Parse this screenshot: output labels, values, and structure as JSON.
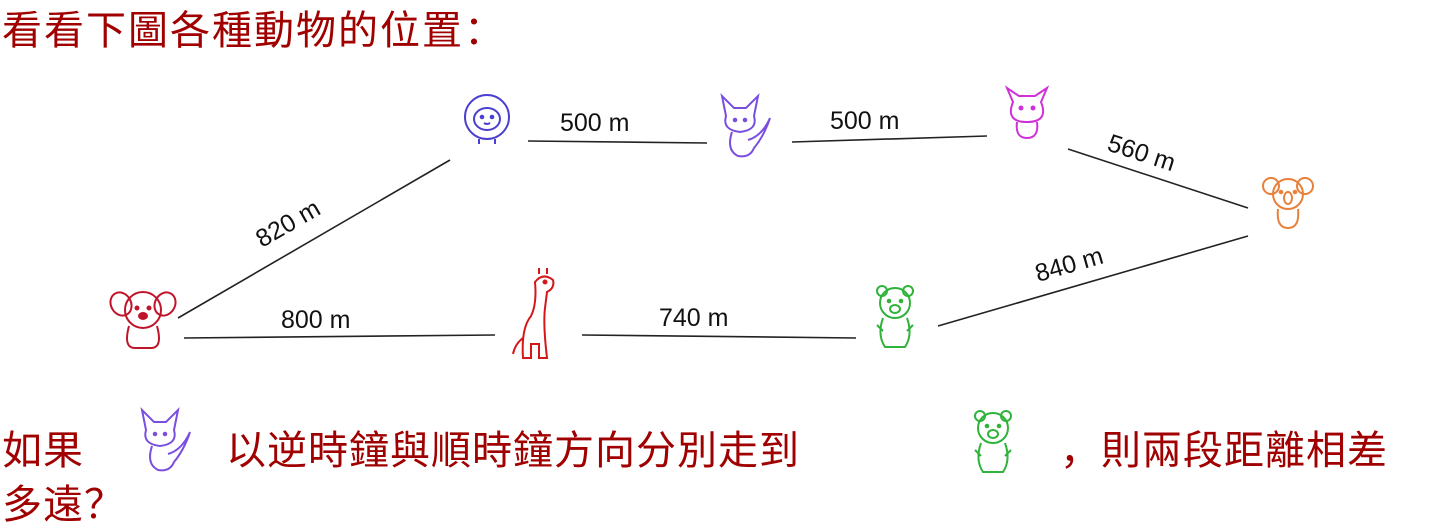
{
  "title": "看看下圖各種動物的位置：",
  "colors": {
    "text": "#a00000",
    "dog": "#c0142a",
    "sheep": "#4b3fd0",
    "fox": "#7a4fe0",
    "cat": "#d030d8",
    "koala": "#e8803a",
    "bear": "#2fb33a",
    "giraffe": "#d41818"
  },
  "edges": {
    "sheep_fox": "500 m",
    "fox_cat": "500 m",
    "cat_koala": "560 m",
    "dog_sheep": "820 m",
    "dog_giraffe": "800 m",
    "giraffe_bear": "740 m",
    "bear_koala": "840 m"
  },
  "question": {
    "part1": "如果",
    "part2": "以逆時鐘與順時鐘方向分別走到",
    "part3": "，則兩段距離相差",
    "part4": "多遠？"
  }
}
